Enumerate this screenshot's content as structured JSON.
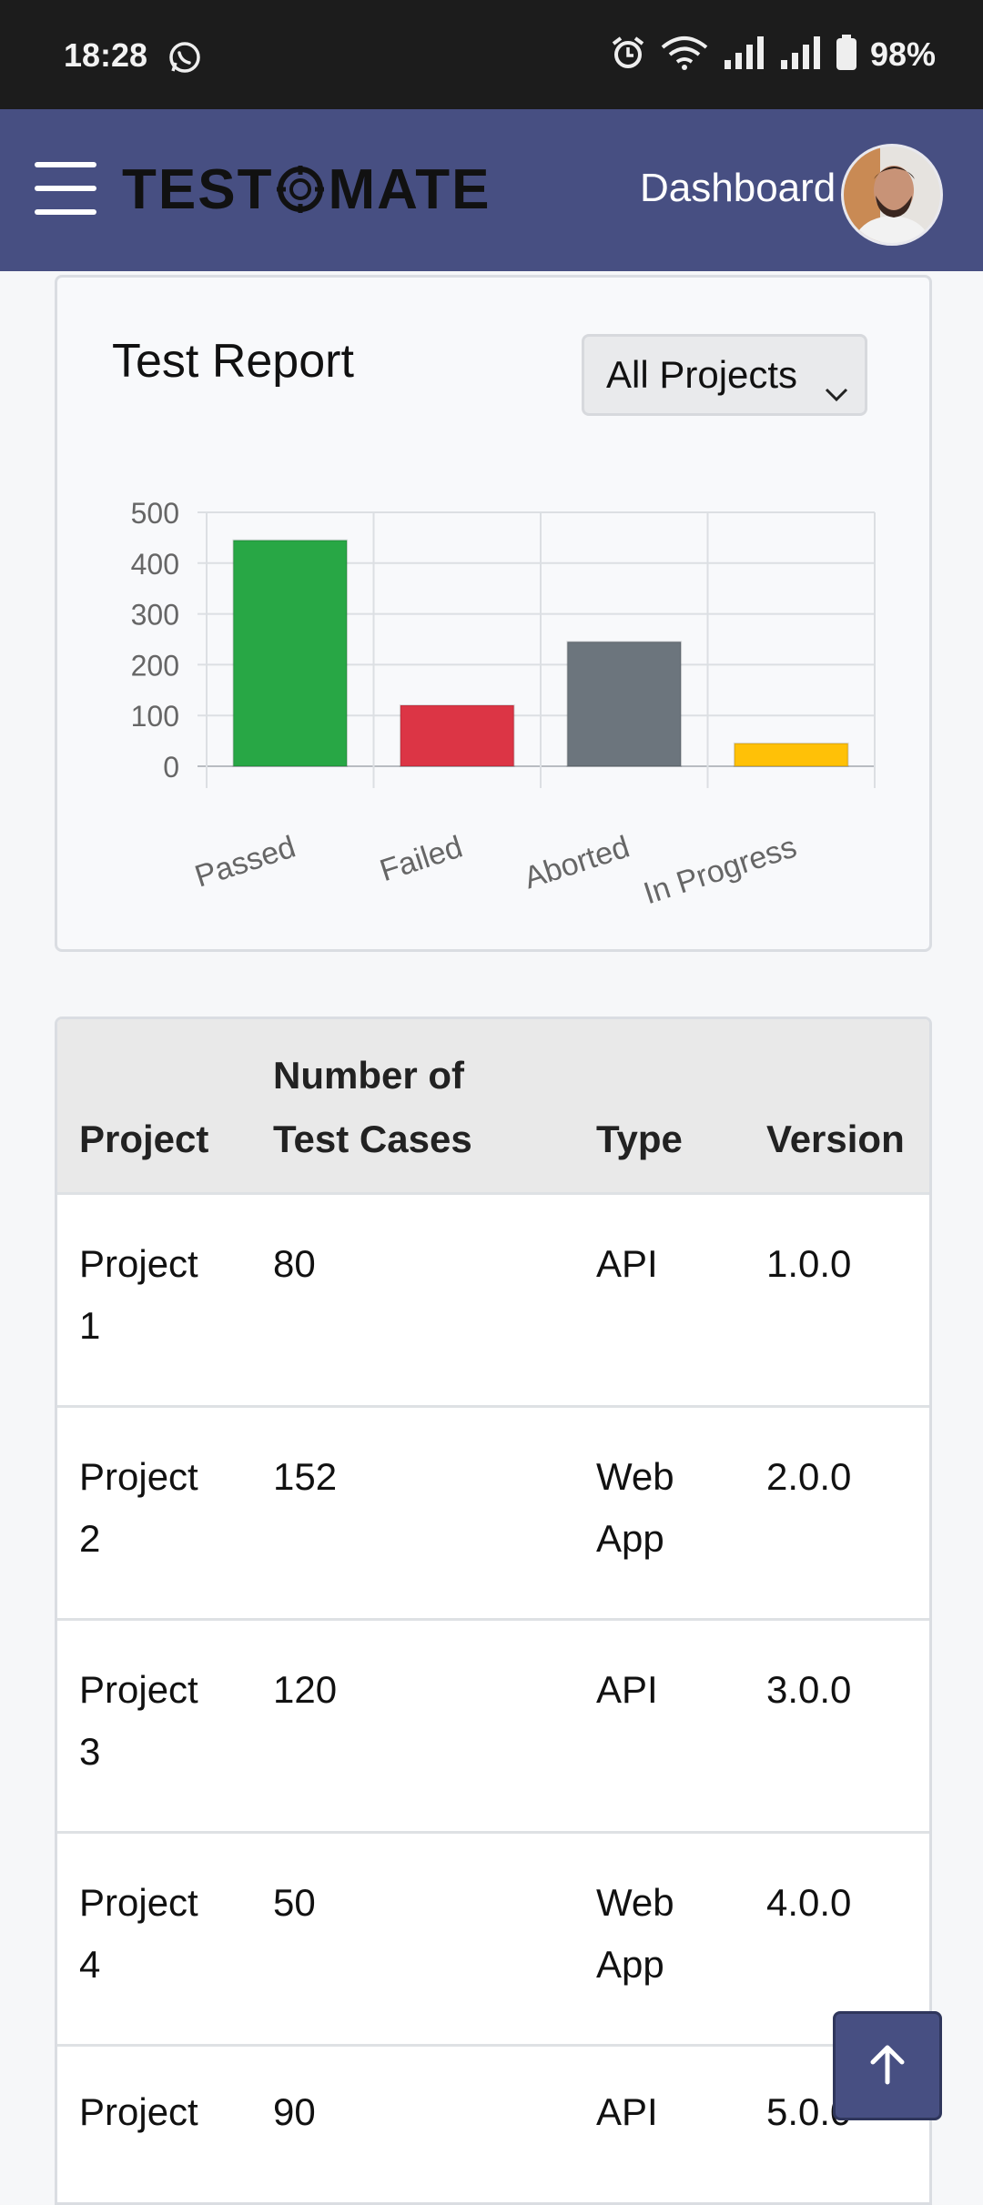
{
  "status_bar": {
    "time": "18:28",
    "battery": "98%"
  },
  "navbar": {
    "logo": "TESTOMATE",
    "logo_left": "TEST",
    "logo_right": "MATE",
    "link": "Dashboard"
  },
  "report": {
    "title": "Test Report",
    "filter": {
      "selected": "All Projects"
    }
  },
  "chart_data": {
    "type": "bar",
    "categories": [
      "Passed",
      "Failed",
      "Aborted",
      "In Progress"
    ],
    "values": [
      445,
      120,
      245,
      45
    ],
    "colors": [
      "#28a745",
      "#dc3545",
      "#6c757d",
      "#ffc107"
    ],
    "ylim": [
      0,
      500
    ],
    "yticks": [
      "500",
      "400",
      "300",
      "200",
      "100",
      "0"
    ],
    "grid": true
  },
  "table": {
    "headers": {
      "project": "Project",
      "cases_line1": "Number of",
      "cases_line2": "Test Cases",
      "type": "Type",
      "version": "Version"
    },
    "rows": [
      {
        "project_a": "Project",
        "project_b": "1",
        "cases": "80",
        "type_a": "API",
        "type_b": "",
        "version": "1.0.0"
      },
      {
        "project_a": "Project",
        "project_b": "2",
        "cases": "152",
        "type_a": "Web",
        "type_b": "App",
        "version": "2.0.0"
      },
      {
        "project_a": "Project",
        "project_b": "3",
        "cases": "120",
        "type_a": "API",
        "type_b": "",
        "version": "3.0.0"
      },
      {
        "project_a": "Project",
        "project_b": "4",
        "cases": "50",
        "type_a": "Web",
        "type_b": "App",
        "version": "4.0.0"
      },
      {
        "project_a": "Project",
        "project_b": "",
        "cases": "90",
        "type_a": "API",
        "type_b": "",
        "version": "5.0.0"
      }
    ]
  }
}
